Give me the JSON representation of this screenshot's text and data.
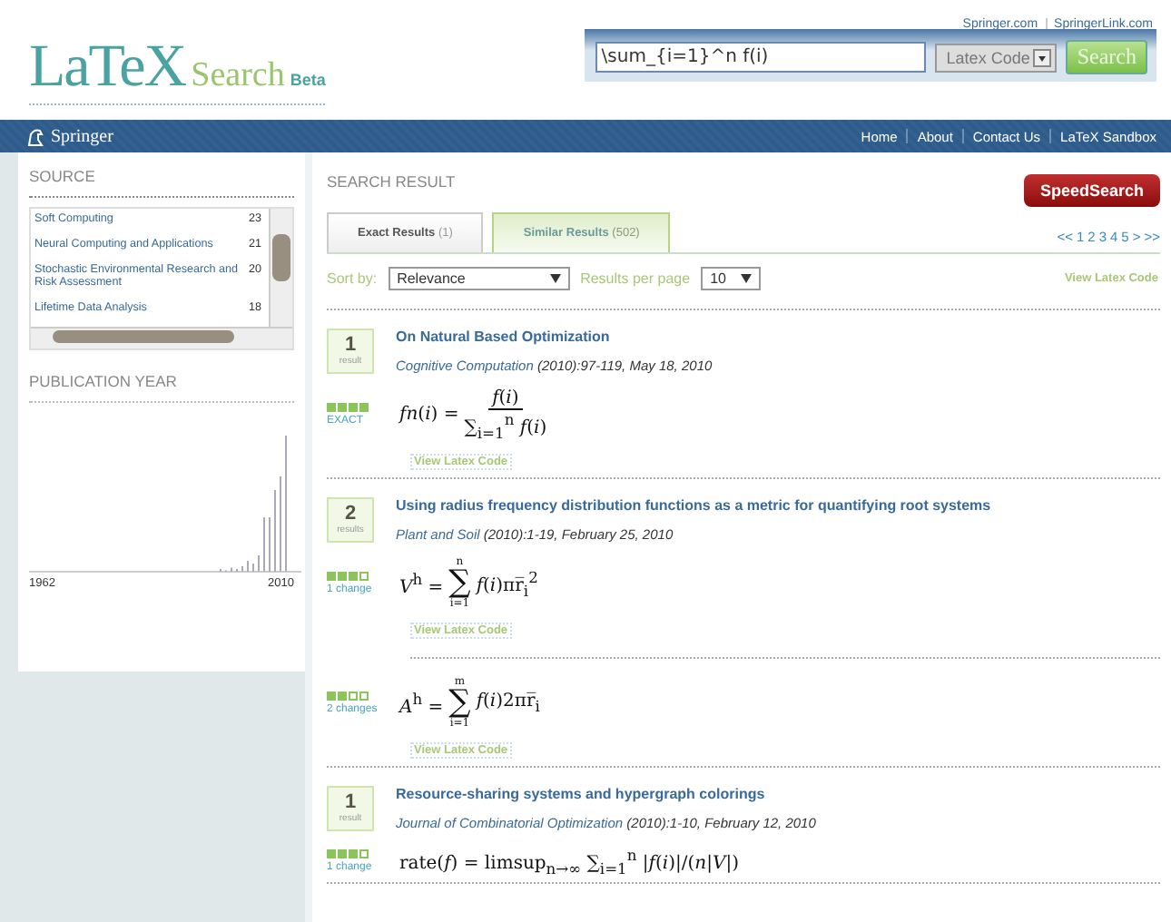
{
  "top_links": [
    "Springer.com",
    "SpringerLink.com"
  ],
  "logo": {
    "main": "LaTeX",
    "sub": "Search",
    "badge": "Beta"
  },
  "search": {
    "value": "\\sum_{i=1}^n f(i)",
    "mode": "Latex Code",
    "button": "Search"
  },
  "navbar": {
    "brand": "Springer",
    "links": [
      "Home",
      "About",
      "Contact Us",
      "LaTeX Sandbox"
    ]
  },
  "sidebar": {
    "source_title": "SOURCE",
    "sources": [
      {
        "name": "Soft Computing",
        "count": "23"
      },
      {
        "name": "Neural Computing and Applications",
        "count": "21"
      },
      {
        "name": "Stochastic Environmental Research and Risk Assessment",
        "count": "20"
      },
      {
        "name": "Lifetime Data Analysis",
        "count": "18"
      }
    ],
    "year_title": "PUBLICATION YEAR",
    "year_from": "1962",
    "year_to": "2010"
  },
  "main": {
    "title": "SEARCH RESULT",
    "speed_button": "SpeedSearch",
    "tabs": [
      {
        "label": "Exact Results",
        "count": "(1)",
        "selected": false
      },
      {
        "label": "Similar Results",
        "count": "(502)",
        "selected": true
      }
    ],
    "pages": [
      "<<",
      "1",
      "2",
      "3",
      "4",
      "5",
      ">",
      ">>"
    ],
    "sort_label": "Sort by:",
    "sort_value": "Relevance",
    "per_page_label": "Results per page",
    "per_page_value": "10",
    "view_code": "View Latex Code",
    "results": [
      {
        "count": "1",
        "count_label": "result",
        "title": "On Natural Based Optimization",
        "journal": "Cognitive Computation",
        "details": "(2010):97-119, May 18, 2010",
        "matches": [
          {
            "stars": 4,
            "match": "EXACT",
            "kind": "fraction",
            "lhs": "*fn*(*i*) =",
            "num": "*f*(*i*)",
            "den": "∑$_{i=1}$$^{n}$ *f*(*i*)",
            "view": "View Latex Code"
          }
        ]
      },
      {
        "count": "2",
        "count_label": "results",
        "title": "Using radius frequency distribution functions as a metric for quantifying root systems",
        "journal": "Plant and Soil",
        "details": "(2010):1-19, February 25, 2010",
        "matches": [
          {
            "stars": 3,
            "match": "1 change",
            "kind": "sum",
            "lhs": "*V*$^{h}$ =",
            "upper": "n",
            "operator": "∑",
            "lower": "i=1",
            "body": "*f*(*i*)πr̅$_{i}$$^{2}$",
            "view": "View Latex Code"
          },
          {
            "stars": 2,
            "match": "2 changes",
            "kind": "sum",
            "lhs": "*A*$^{h}$ =",
            "upper": "m",
            "operator": "∑",
            "lower": "i=1",
            "body": "*f*(*i*)2πr̅$_{i}$",
            "view": "View Latex Code"
          }
        ]
      },
      {
        "count": "1",
        "count_label": "result",
        "title": "Resource-sharing systems and hypergraph colorings",
        "journal": "Journal of Combinatorial Optimization",
        "details": "(2010):1-10, February 12, 2010",
        "matches": [
          {
            "stars": 3,
            "match": "1 change",
            "kind": "inline",
            "text": "rate(*f*) = limsup$_{n→∞}$ ∑$_{i=1}$$^{n}$ |*f*(*i*)|/(*n*|*V*|)"
          }
        ]
      }
    ]
  }
}
